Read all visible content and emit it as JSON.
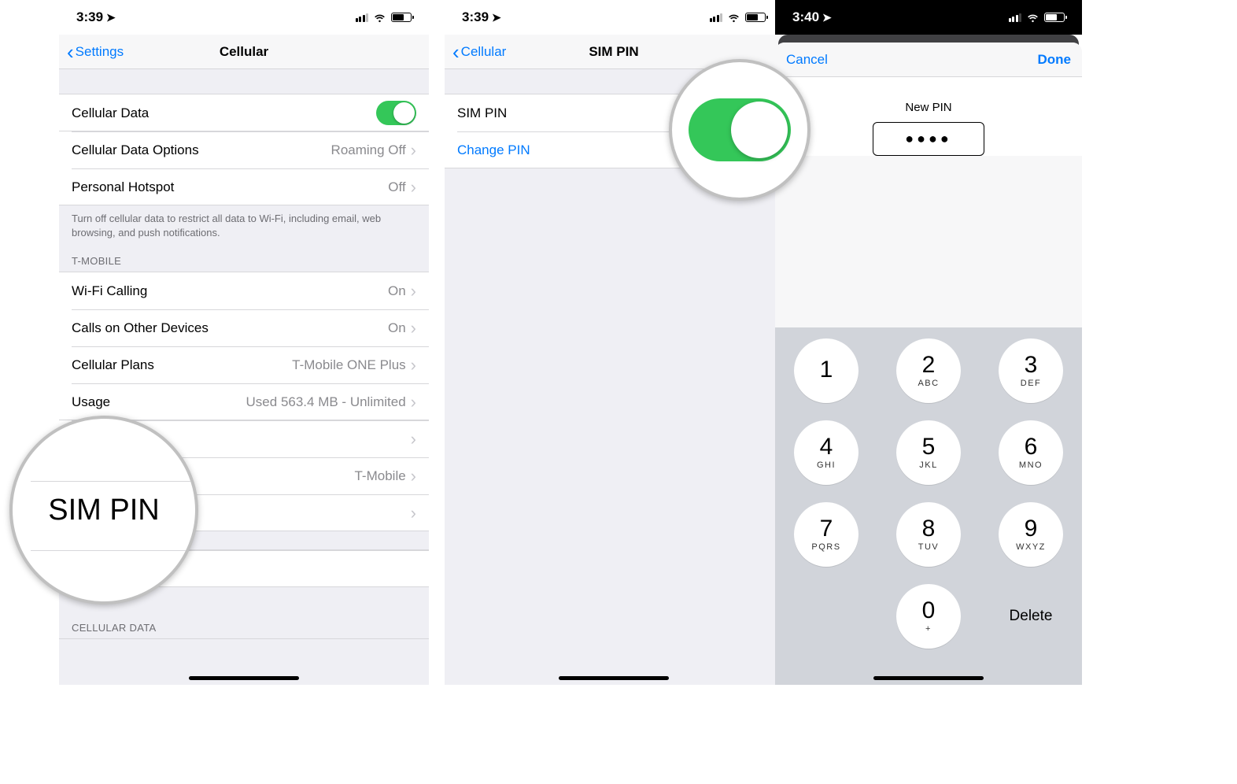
{
  "screen1": {
    "time": "3:39",
    "back_label": "Settings",
    "title": "Cellular",
    "rows": {
      "cellular_data": "Cellular Data",
      "cellular_data_options": "Cellular Data Options",
      "cellular_data_options_detail": "Roaming Off",
      "personal_hotspot": "Personal Hotspot",
      "personal_hotspot_detail": "Off",
      "footer": "Turn off cellular data to restrict all data to Wi-Fi, including email, web browsing, and push notifications.",
      "carrier_section": "T-MOBILE",
      "wifi_calling": "Wi-Fi Calling",
      "wifi_calling_detail": "On",
      "calls_other": "Calls on Other Devices",
      "calls_other_detail": "On",
      "cellular_plans": "Cellular Plans",
      "cellular_plans_detail": "T-Mobile ONE Plus",
      "usage": "Usage",
      "usage_detail": "Used 563.4 MB - Unlimited",
      "carrier_detail": "T-Mobile",
      "cellular_data_section": "CELLULAR DATA"
    },
    "zoom_label": "SIM PIN"
  },
  "screen2": {
    "time": "3:39",
    "back_label": "Cellular",
    "title": "SIM PIN",
    "sim_pin_row": "SIM PIN",
    "change_pin": "Change PIN"
  },
  "screen3": {
    "time": "3:40",
    "cancel": "Cancel",
    "done": "Done",
    "new_pin_label": "New PIN",
    "pin_value": "●●●●",
    "keys": [
      {
        "num": "1",
        "sub": ""
      },
      {
        "num": "2",
        "sub": "ABC"
      },
      {
        "num": "3",
        "sub": "DEF"
      },
      {
        "num": "4",
        "sub": "GHI"
      },
      {
        "num": "5",
        "sub": "JKL"
      },
      {
        "num": "6",
        "sub": "MNO"
      },
      {
        "num": "7",
        "sub": "PQRS"
      },
      {
        "num": "8",
        "sub": "TUV"
      },
      {
        "num": "9",
        "sub": "WXYZ"
      },
      {
        "num": "0",
        "sub": "+"
      }
    ],
    "delete": "Delete"
  }
}
